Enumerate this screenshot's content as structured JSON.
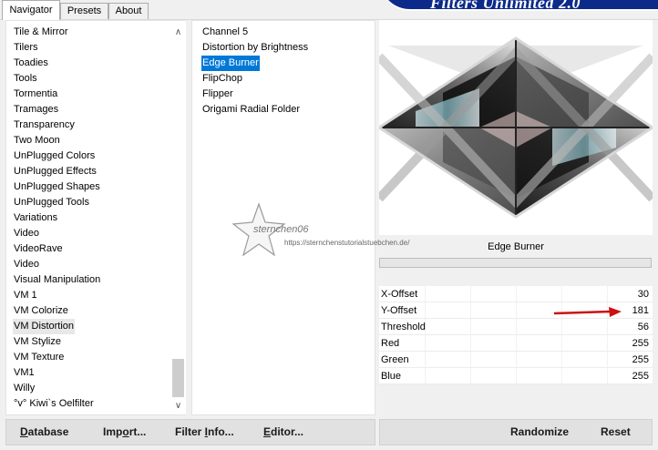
{
  "tabs": [
    "Navigator",
    "Presets",
    "About"
  ],
  "banner": {
    "title": "Filters Unlimited 2.0"
  },
  "categories": [
    "Tile & Mirror",
    "Tilers",
    "Toadies",
    "Tools",
    "Tormentia",
    "Tramages",
    "Transparency",
    "Two Moon",
    "UnPlugged Colors",
    "UnPlugged Effects",
    "UnPlugged Shapes",
    "UnPlugged Tools",
    "Variations",
    "Video",
    "VideoRave",
    "Video",
    "Visual Manipulation",
    "VM 1",
    "VM Colorize",
    "VM Distortion",
    "VM Stylize",
    "VM Texture",
    "VM1",
    "Willy",
    "°v° Kiwi`s Oelfilter"
  ],
  "selected_category": "VM Distortion",
  "filters": [
    "Channel 5",
    "Distortion by Brightness",
    "Edge Burner",
    "FlipChop",
    "Flipper",
    "Origami Radial Folder"
  ],
  "selected_filter": "Edge Burner",
  "preview_filter_name": "Edge Burner",
  "params": [
    {
      "label": "X-Offset",
      "value": "30"
    },
    {
      "label": "Y-Offset",
      "value": "181"
    },
    {
      "label": "Threshold",
      "value": "56"
    },
    {
      "label": "Red",
      "value": "255"
    },
    {
      "label": "Green",
      "value": "255"
    },
    {
      "label": "Blue",
      "value": "255"
    }
  ],
  "watermark": {
    "name": "sternchen06",
    "url": "https://sternchenstutorialstuebchen.de/"
  },
  "buttons": {
    "database": {
      "ul": "D",
      "rest": "atabase"
    },
    "import": {
      "pre": "Imp",
      "ul": "o",
      "rest": "rt..."
    },
    "filter_info": {
      "pre": "Filter ",
      "ul": "I",
      "rest": "nfo..."
    },
    "editor": {
      "ul": "E",
      "rest": "ditor..."
    },
    "randomize": "Randomize",
    "reset": "Reset"
  },
  "colors": {
    "selection_blue": "#0078d7",
    "banner_blue": "#0c2a8a",
    "arrow_red": "#cc1111"
  }
}
